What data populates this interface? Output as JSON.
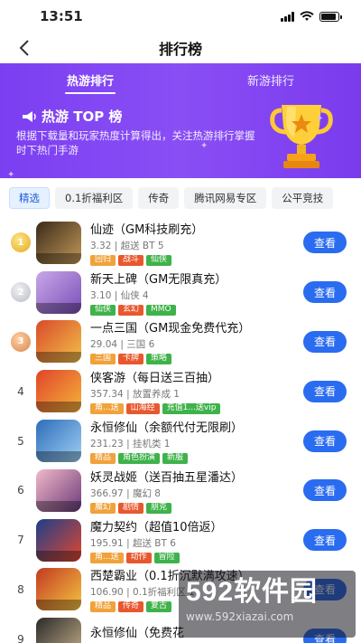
{
  "status": {
    "time": "13:51",
    "battery_level": 0.9
  },
  "nav": {
    "back_icon": "chevron-left-icon",
    "title": "排行榜"
  },
  "banner": {
    "tabs": [
      {
        "label": "热游排行",
        "active": true
      },
      {
        "label": "新游排行",
        "active": false
      }
    ],
    "headline": "热游 TOP 榜",
    "description": "根据下载量和玩家热度计算得出，关注热游排行掌握时下热门手游",
    "colors": {
      "bg": "#7b3ff2"
    }
  },
  "categories": [
    {
      "label": "精选",
      "active": true
    },
    {
      "label": "0.1折福利区",
      "active": false
    },
    {
      "label": "传奇",
      "active": false
    },
    {
      "label": "腾讯网易专区",
      "active": false
    },
    {
      "label": "公平竞技",
      "active": false
    }
  ],
  "games": [
    {
      "rank": "1",
      "title": "仙迹（GM科技刷充）",
      "meta": "3.32 | 超送 BT 5",
      "tags": [
        "回归",
        "战斗",
        "仙侠"
      ],
      "colors": [
        "#f0a23b",
        "#e8582f",
        "#3fb24a"
      ],
      "icon_colors": [
        "#3a2a1a",
        "#c49a5a"
      ]
    },
    {
      "rank": "2",
      "title": "新天上碑（GM无限真充）",
      "meta": "3.10 | 仙侠 4",
      "tags": [
        "仙侠",
        "玄幻",
        "MMO"
      ],
      "colors": [
        "#3fb24a",
        "#e8582f",
        "#3fb24a"
      ],
      "icon_colors": [
        "#c9a7e8",
        "#7a4fb8"
      ]
    },
    {
      "rank": "3",
      "title": "一点三国（GM现金免费代充）",
      "meta": "29.04 | 三国 6",
      "tags": [
        "三国",
        "卡牌",
        "策略"
      ],
      "colors": [
        "#f0a23b",
        "#e8582f",
        "#3fb24a"
      ],
      "icon_colors": [
        "#d84a2a",
        "#f2c14a"
      ]
    },
    {
      "rank": "4",
      "title": "侠客游（每日送三百抽）",
      "meta": "357.34 | 放置养成 1",
      "tags": [
        "角...送",
        "山海经",
        "充值1...送vip"
      ],
      "colors": [
        "#f0a23b",
        "#e8582f",
        "#3fb24a"
      ],
      "icon_colors": [
        "#e0442b",
        "#f5b43a"
      ]
    },
    {
      "rank": "5",
      "title": "永恒修仙（余额代付无限刷）",
      "meta": "231.23 | 挂机类 1",
      "tags": [
        "精品",
        "角色扮演",
        "新服"
      ],
      "colors": [
        "#f0a23b",
        "#3fb24a",
        "#3fb24a"
      ],
      "icon_colors": [
        "#2d6cb8",
        "#9fd0f5"
      ]
    },
    {
      "rank": "6",
      "title": "妖灵战姬（送百抽五星潘达）",
      "meta": "366.97 | 魔幻 8",
      "tags": [
        "魔幻",
        "剧情",
        "朋克"
      ],
      "colors": [
        "#f0a23b",
        "#e8582f",
        "#3fb24a"
      ],
      "icon_colors": [
        "#f2b9c8",
        "#6a3a7a"
      ]
    },
    {
      "rank": "7",
      "title": "魔力契约（超值10倍返）",
      "meta": "195.91 | 超送 BT 6",
      "tags": [
        "角...送",
        "动作",
        "冒险"
      ],
      "colors": [
        "#f0a23b",
        "#e8582f",
        "#3fb24a"
      ],
      "icon_colors": [
        "#1c3f8a",
        "#e2472f"
      ]
    },
    {
      "rank": "8",
      "title": "西楚霸业（0.1折沉默满攻速）",
      "meta": "106.90 | 0.1折福利区 1",
      "tags": [
        "精品",
        "传奇",
        "复古"
      ],
      "colors": [
        "#f0a23b",
        "#e8582f",
        "#3fb24a"
      ],
      "icon_colors": [
        "#c23a22",
        "#f5c542"
      ]
    },
    {
      "rank": "9",
      "title": "永恒修仙（免费花",
      "meta": "233.23 | 挂机类 1",
      "tags": [],
      "colors": [],
      "icon_colors": [
        "#2a2a2a",
        "#c9b28a"
      ]
    }
  ],
  "view_label": "查看",
  "watermark": {
    "brand_num": "592",
    "brand_cn": "软件园",
    "url": "www.592xiazai.com"
  }
}
